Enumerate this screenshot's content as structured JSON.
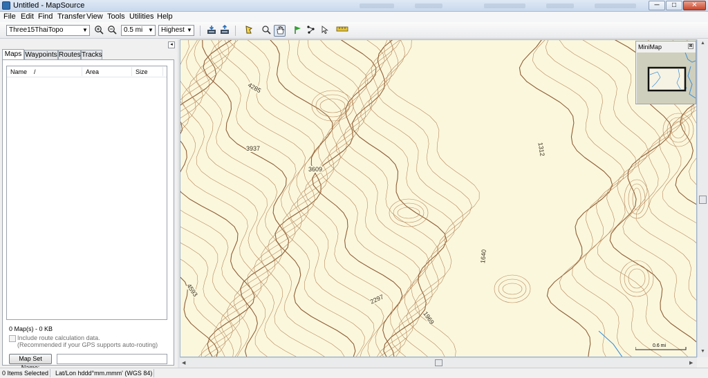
{
  "window": {
    "title": "Untitled - MapSource",
    "minimize": "─",
    "maximize": "□",
    "close": "✕"
  },
  "menu": [
    "File",
    "Edit",
    "Find",
    "Transfer",
    "View",
    "Tools",
    "Utilities",
    "Help"
  ],
  "toolbar": {
    "map_product": "Three15ThaiTopo",
    "zoom_scale": "0.5 mi",
    "detail_level": "Highest",
    "icons": [
      "zoom-in-icon",
      "zoom-out-icon",
      "receive-from-device-icon",
      "send-to-device-icon",
      "selection-tool-icon",
      "zoom-tool-icon",
      "hand-tool-icon",
      "waypoint-tool-icon",
      "route-tool-icon",
      "track-tool-icon",
      "distance-tool-icon"
    ]
  },
  "sidebar": {
    "collapse_glyph": "◂",
    "tabs": [
      "Maps",
      "Waypoints",
      "Routes",
      "Tracks"
    ],
    "selected_tab": "Maps",
    "columns": [
      "Name",
      "/",
      "Area",
      "Size"
    ],
    "rows": [],
    "summary": "0 Map(s) - 0 KB",
    "checkbox_label_1": "Include route calculation data.",
    "checkbox_label_2": "(Recommended if your GPS supports auto-routing)",
    "checkbox_checked": false,
    "mapset_button": "Map Set Name:",
    "mapset_value": ""
  },
  "map": {
    "contour_labels": [
      "4285",
      "3937",
      "3609",
      "1312",
      "1640",
      "2297",
      "1969",
      "4593"
    ],
    "minimap_title": "MiniMap",
    "minimap_close": "⊠",
    "scale_label": "0.6 mi",
    "colors": {
      "background": "#fbf7dd",
      "contour": "#b7875a",
      "contour_major": "#8f5e35",
      "water": "#3a8fd8"
    }
  },
  "status": {
    "items_selected": "0 Items Selected",
    "position_format": "Lat/Lon hddd°mm.mmm' (WGS 84)"
  }
}
